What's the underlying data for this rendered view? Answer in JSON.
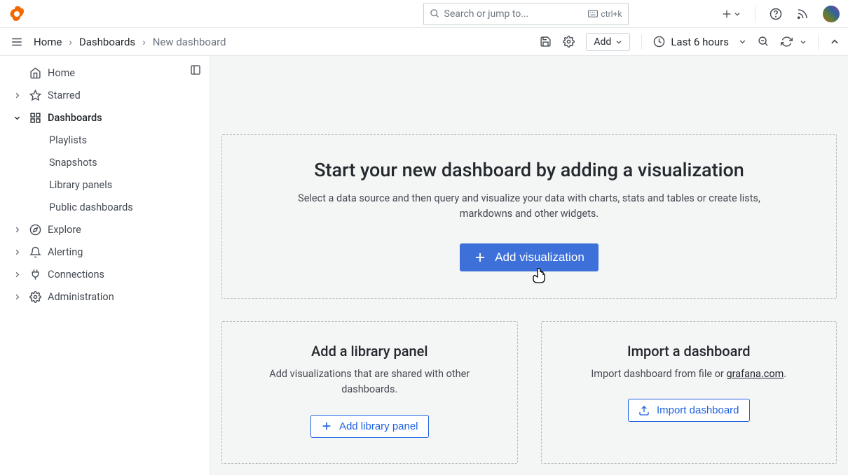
{
  "topbar": {
    "search_placeholder": "Search or jump to...",
    "search_shortcut": "ctrl+k"
  },
  "breadcrumb": {
    "items": [
      "Home",
      "Dashboards",
      "New dashboard"
    ]
  },
  "toolbar": {
    "add_label": "Add",
    "time_label": "Last 6 hours"
  },
  "sidebar": {
    "home": "Home",
    "starred": "Starred",
    "dashboards": "Dashboards",
    "dashboards_sub": {
      "playlists": "Playlists",
      "snapshots": "Snapshots",
      "library_panels": "Library panels",
      "public_dashboards": "Public dashboards"
    },
    "explore": "Explore",
    "alerting": "Alerting",
    "connections": "Connections",
    "administration": "Administration"
  },
  "hero": {
    "title": "Start your new dashboard by adding a visualization",
    "subtitle": "Select a data source and then query and visualize your data with charts, stats and tables or create lists, markdowns and other widgets.",
    "button": "Add visualization"
  },
  "library_card": {
    "title": "Add a library panel",
    "subtitle": "Add visualizations that are shared with other dashboards.",
    "button": "Add library panel"
  },
  "import_card": {
    "title": "Import a dashboard",
    "subtitle_prefix": "Import dashboard from file or ",
    "subtitle_link": "grafana.com",
    "subtitle_suffix": ".",
    "button": "Import dashboard"
  }
}
